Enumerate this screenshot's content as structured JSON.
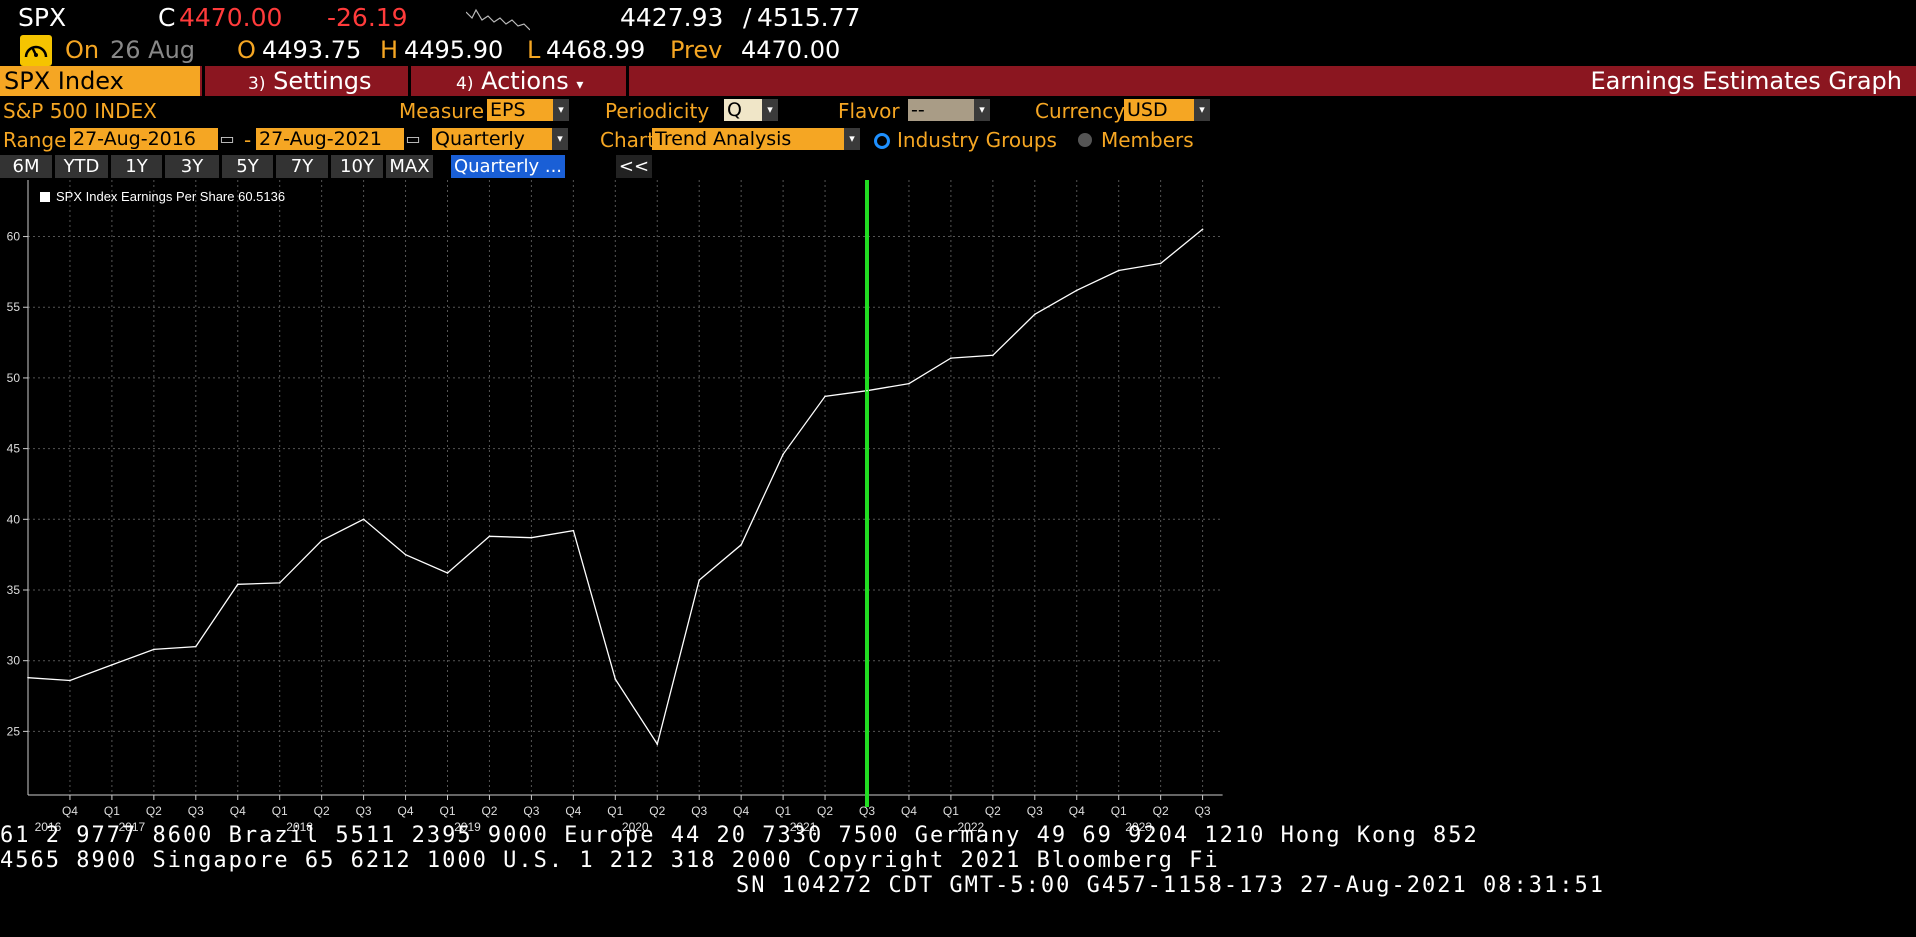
{
  "header": {
    "ticker": "SPX",
    "close_prefix": "C",
    "close": "4470.00",
    "change": "-26.19",
    "bid": "4427.93",
    "separator": "/",
    "ask": "4515.77",
    "on_label": "On",
    "date": "26 Aug",
    "open_label": "O",
    "open": "4493.75",
    "high_label": "H",
    "high": "4495.90",
    "low_label": "L",
    "low": "4468.99",
    "prev_label": "Prev",
    "prev": "4470.00"
  },
  "toolbar": {
    "index_tab": "SPX Index",
    "settings_num": "3)",
    "settings": "Settings",
    "actions_num": "4)",
    "actions": "Actions",
    "actions_arrow": "▾",
    "title": "Earnings Estimates Graph"
  },
  "controls": {
    "security_name": "S&P 500 INDEX",
    "measure_label": "Measure",
    "measure_value": "EPS",
    "periodicity_label": "Periodicity",
    "periodicity_value": "Q",
    "flavor_label": "Flavor",
    "flavor_value": "--",
    "currency_label": "Currency",
    "currency_value": "USD",
    "range_label": "Range",
    "range_start": "27-Aug-2016",
    "range_dash": "-",
    "range_end": "27-Aug-2021",
    "range_period": "Quarterly",
    "chart_label": "Chart",
    "chart_value": "Trend Analysis",
    "radio_industry": "Industry Groups",
    "radio_members": "Members",
    "dropdown_arrow": "▾",
    "calendar_glyph": "▭",
    "period_buttons": [
      "6M",
      "YTD",
      "1Y",
      "3Y",
      "5Y",
      "7Y",
      "10Y",
      "MAX"
    ],
    "period_active": "Quarterly ...",
    "collapse": "<<"
  },
  "chart_data": {
    "type": "line",
    "legend": "SPX Index Earnings Per Share 60.5136",
    "x_quarters": [
      "Q3",
      "Q4",
      "Q1",
      "Q2",
      "Q3",
      "Q4",
      "Q1",
      "Q2",
      "Q3",
      "Q4",
      "Q1",
      "Q2",
      "Q3",
      "Q4",
      "Q1",
      "Q2",
      "Q3",
      "Q4",
      "Q1",
      "Q2",
      "Q3",
      "Q4",
      "Q1",
      "Q2",
      "Q3",
      "Q4",
      "Q1",
      "Q2",
      "Q3"
    ],
    "x_tick_labels": [
      "Q4",
      "Q1",
      "Q2",
      "Q3",
      "Q4",
      "Q1",
      "Q2",
      "Q3",
      "Q4",
      "Q1",
      "Q2",
      "Q3",
      "Q4",
      "Q1",
      "Q2",
      "Q3",
      "Q4",
      "Q1",
      "Q2",
      "Q3",
      "Q4",
      "Q1",
      "Q2",
      "Q3",
      "Q4",
      "Q1",
      "Q2",
      "Q3"
    ],
    "year_labels": [
      {
        "label": "2016",
        "index": 1
      },
      {
        "label": "2017",
        "index": 3
      },
      {
        "label": "2018",
        "index": 7
      },
      {
        "label": "2019",
        "index": 11
      },
      {
        "label": "2020",
        "index": 15
      },
      {
        "label": "2021",
        "index": 19
      },
      {
        "label": "2022",
        "index": 23
      },
      {
        "label": "2023",
        "index": 27
      }
    ],
    "values": [
      28.8,
      28.6,
      29.7,
      30.8,
      31.0,
      35.4,
      35.5,
      38.5,
      40.0,
      37.5,
      36.2,
      38.8,
      38.7,
      39.2,
      28.7,
      24.1,
      35.7,
      38.2,
      44.6,
      48.7,
      49.1,
      49.6,
      51.4,
      51.6,
      54.5,
      56.2,
      57.6,
      58.1,
      60.5136
    ],
    "y_ticks": [
      25,
      30,
      35,
      40,
      45,
      50,
      55,
      60
    ],
    "ylim": [
      20.5,
      64
    ],
    "marker_index": 20,
    "colors": {
      "line": "#ffffff",
      "marker": "#22dd22",
      "grid": "#555555"
    }
  },
  "footer": {
    "line1": "61 2 9777 8600 Brazil 5511 2395 9000 Europe 44 20 7330 7500 Germany 49 69 9204 1210 Hong Kong 852",
    "line2": " 4565 8900       Singapore 65 6212 1000       U.S. 1 212 318 2000         Copyright 2021 Bloomberg Fi",
    "line3": "SN 104272 CDT  GMT-5:00 G457-1158-173 27-Aug-2021 08:31:51"
  }
}
